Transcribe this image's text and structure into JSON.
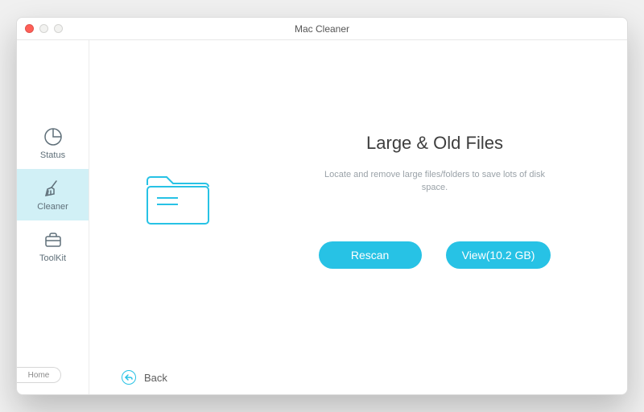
{
  "window": {
    "title": "Mac Cleaner"
  },
  "sidebar": {
    "items": [
      {
        "label": "Status"
      },
      {
        "label": "Cleaner"
      },
      {
        "label": "ToolKit"
      }
    ],
    "home_label": "Home"
  },
  "nav": {
    "back_label": "Back"
  },
  "main": {
    "title": "Large & Old Files",
    "description": "Locate and remove large files/folders to save lots of disk space.",
    "rescan_label": "Rescan",
    "view_label": "View(10.2 GB)"
  },
  "colors": {
    "accent": "#27c2e5"
  }
}
